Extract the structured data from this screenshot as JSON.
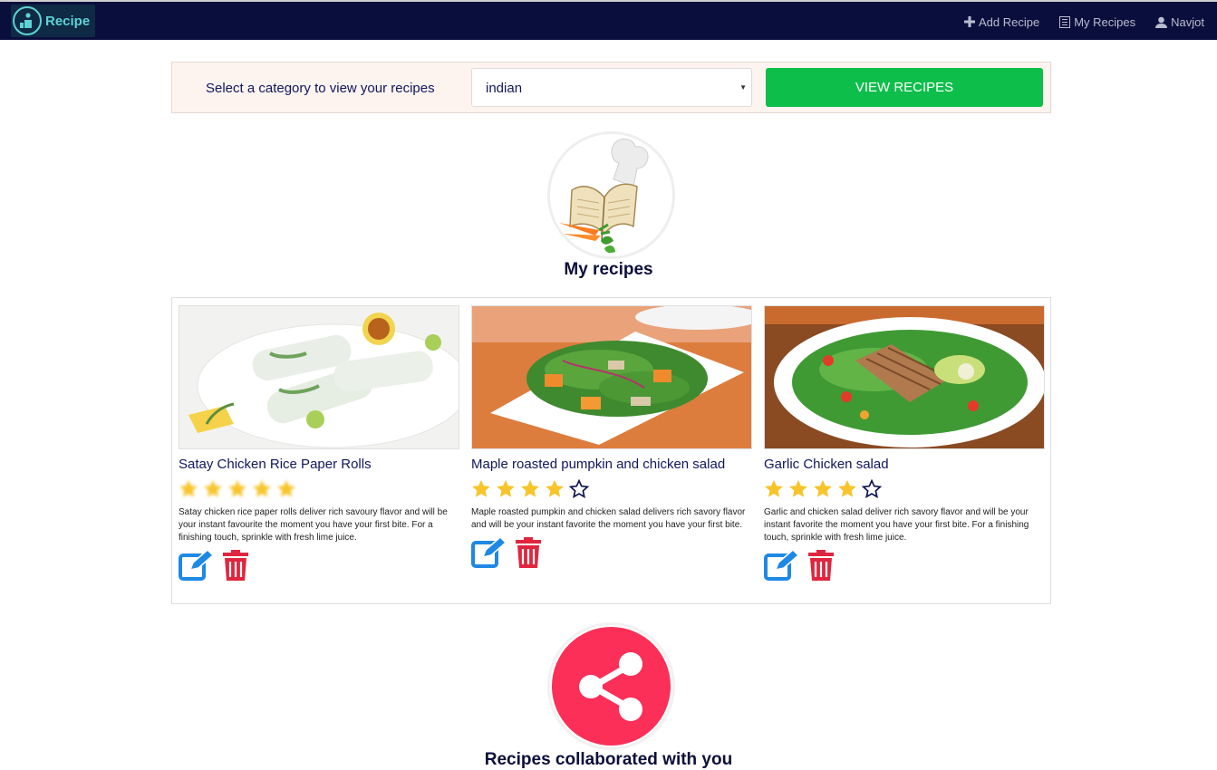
{
  "navbar": {
    "brand": "Recipe",
    "links": [
      {
        "label": "Add Recipe",
        "icon": "plus-icon"
      },
      {
        "label": "My Recipes",
        "icon": "list-icon"
      },
      {
        "label": "Navjot",
        "icon": "user-icon"
      }
    ]
  },
  "category": {
    "label": "Select a category to view your recipes",
    "selected": "indian",
    "button": "VIEW RECIPES"
  },
  "my_recipes": {
    "title": "My recipes",
    "icon": "cookbook-icon",
    "cards": [
      {
        "title": "Satay Chicken Rice Paper Rolls",
        "rating": 5,
        "description": "Satay chicken rice paper rolls deliver rich savoury flavor and will be your instant favourite the moment you have your first bite. For a finishing touch, sprinkle with fresh lime juice."
      },
      {
        "title": "Maple roasted pumpkin and chicken salad",
        "rating": 4,
        "description": "Maple roasted pumpkin and chicken salad delivers rich savory flavor and will be your instant favorite the moment you have your first bite."
      },
      {
        "title": "Garlic Chicken salad",
        "rating": 4,
        "description": "Garlic and chicken salad deliver rich savory flavor and will be your instant favorite the moment you have your first bite. For a finishing touch, sprinkle with fresh lime juice."
      }
    ]
  },
  "collab": {
    "title": "Recipes collaborated with you",
    "icon": "share-icon"
  },
  "colors": {
    "navbar": "#0a0e3c",
    "brand": "#5ed3d6",
    "button": "#0dbf4a",
    "star": "#f7c52b",
    "edit": "#1e88e5",
    "delete": "#e0263f",
    "share": "#fb2f57"
  }
}
